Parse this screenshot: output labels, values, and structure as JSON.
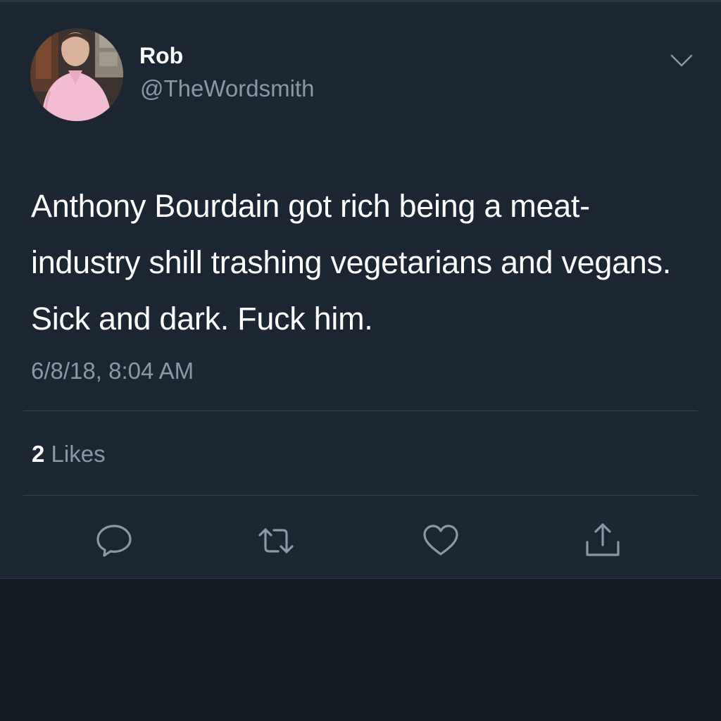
{
  "tweet": {
    "author": {
      "display_name": "Rob",
      "handle": "@TheWordsmith"
    },
    "text": "Anthony Bourdain got rich being a meat-industry shill trashing vegetarians and vegans. Sick and dark. Fuck him.",
    "timestamp": "6/8/18, 8:04 AM",
    "likes": {
      "count": "2",
      "label": "Likes"
    },
    "actions": [
      "reply-icon",
      "retweet-icon",
      "like-icon",
      "share-icon"
    ]
  },
  "colors": {
    "card_background": "#1c2532",
    "page_background": "#141a22",
    "primary_text": "#ffffff",
    "secondary_text": "#8899a6",
    "divider": "#38444d"
  }
}
